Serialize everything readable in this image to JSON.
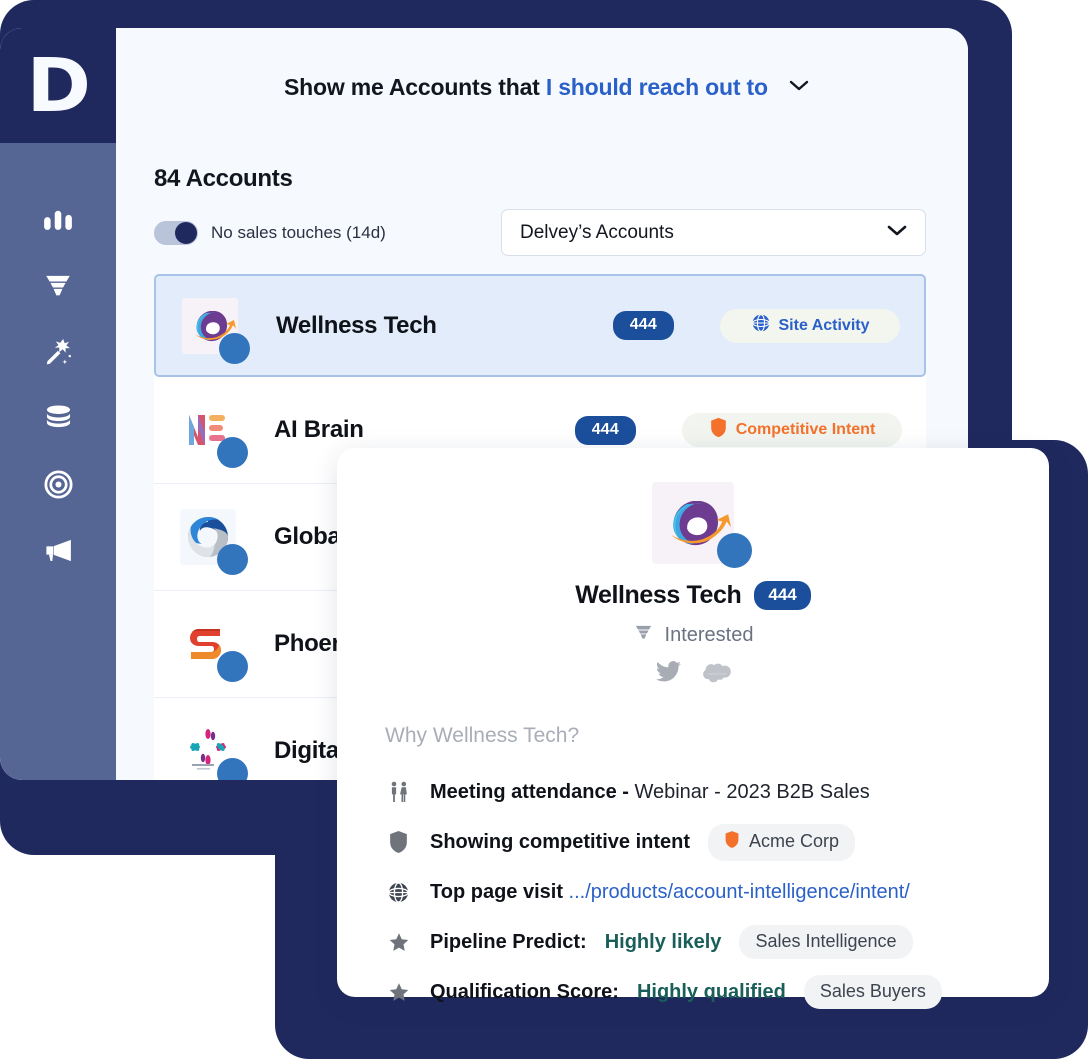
{
  "brand": {
    "logo_letter": "D",
    "navy": "#20295e",
    "sidebar_blue": "#556695",
    "accent_blue": "#2a61c8",
    "pill_blue": "#1b4f9c",
    "orange": "#f4712c",
    "green": "#1a5e5a"
  },
  "sidebar": {
    "items": [
      {
        "name": "analytics-icon",
        "label": "Analytics"
      },
      {
        "name": "funnel-icon",
        "label": "Funnel"
      },
      {
        "name": "magic-wand-icon",
        "label": "Recommendations"
      },
      {
        "name": "database-icon",
        "label": "Data"
      },
      {
        "name": "target-icon",
        "label": "Targets"
      },
      {
        "name": "megaphone-icon",
        "label": "Campaigns"
      }
    ]
  },
  "header": {
    "query_prefix": "Show me Accounts that",
    "query_value": "I should reach out to",
    "caret_icon": "chevron-down-icon"
  },
  "toolbar": {
    "accounts_count": "84 Accounts",
    "toggle_label": "No sales touches (14d)",
    "toggle_on": true,
    "select_value": "Delvey’s Accounts",
    "select_caret_icon": "chevron-down-icon"
  },
  "accounts": [
    {
      "name": "Wellness Tech",
      "score": "444",
      "signal": "Site Activity",
      "signal_icon": "globe-www-icon",
      "signal_style": "site",
      "selected": true,
      "logo": "wellness-tech-logo"
    },
    {
      "name": "AI Brain",
      "score": "444",
      "signal": "Competitive Intent",
      "signal_icon": "shield-icon",
      "signal_style": "competitive",
      "selected": false,
      "logo": "ai-brain-logo"
    },
    {
      "name": "Global",
      "score": "",
      "signal": "",
      "signal_icon": "",
      "signal_style": "",
      "selected": false,
      "logo": "global-logo"
    },
    {
      "name": "Phoenix",
      "score": "",
      "signal": "",
      "signal_icon": "",
      "signal_style": "",
      "selected": false,
      "logo": "phoenix-logo"
    },
    {
      "name": "Digital",
      "score": "",
      "signal": "",
      "signal_icon": "",
      "signal_style": "",
      "selected": false,
      "logo": "digital-logo"
    }
  ],
  "detail_card": {
    "logo": "wellness-tech-logo",
    "title": "Wellness Tech",
    "score": "444",
    "stage_icon": "funnel-icon",
    "stage": "Interested",
    "socials": [
      "twitter-icon",
      "salesforce-cloud-icon"
    ],
    "why_title": "Why Wellness Tech?",
    "reasons": [
      {
        "icon": "people-icon",
        "strong": "Meeting attendance -",
        "normal": " Webinar - 2023 B2B Sales",
        "link": "",
        "green": "",
        "chip": "",
        "chip_icon": ""
      },
      {
        "icon": "shield-icon",
        "strong": "Showing competitive intent",
        "normal": "",
        "link": "",
        "green": "",
        "chip": "Acme Corp",
        "chip_icon": "shield-icon"
      },
      {
        "icon": "globe-www-icon",
        "strong": "Top page visit ",
        "normal": "...",
        "link": "/products/account-intelligence/intent/",
        "green": "",
        "chip": "",
        "chip_icon": ""
      },
      {
        "icon": "star-icon",
        "strong": "Pipeline Predict:",
        "normal": "",
        "link": "",
        "green": "Highly likely",
        "chip": "Sales Intelligence",
        "chip_icon": ""
      },
      {
        "icon": "star-icon",
        "strong": "Qualification Score:",
        "normal": "",
        "link": "",
        "green": "Highly qualified",
        "chip": "Sales Buyers",
        "chip_icon": ""
      }
    ]
  }
}
